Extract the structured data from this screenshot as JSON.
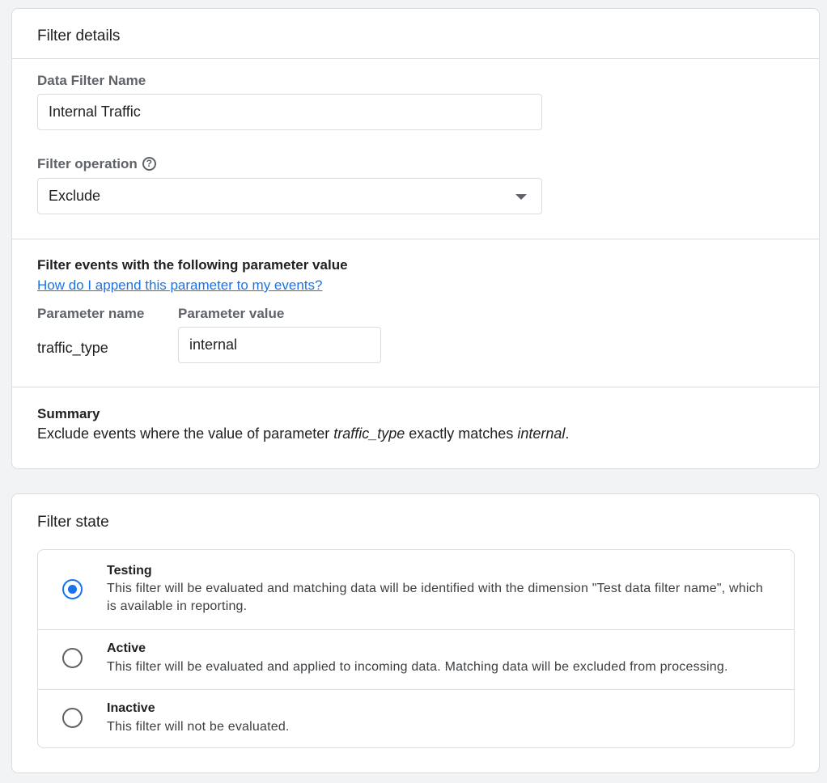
{
  "details": {
    "title": "Filter details",
    "name_label": "Data Filter Name",
    "name_value": "Internal Traffic",
    "operation_label": "Filter operation",
    "help_icon_glyph": "?",
    "operation_value": "Exclude"
  },
  "params": {
    "heading": "Filter events with the following parameter value",
    "help_link": "How do I append this parameter to my events?",
    "name_header": "Parameter name",
    "value_header": "Parameter value",
    "name": "traffic_type",
    "value": "internal"
  },
  "summary": {
    "heading": "Summary",
    "prefix": "Exclude events where the value of parameter ",
    "param": "traffic_type",
    "middle": " exactly matches ",
    "value": "internal",
    "suffix": "."
  },
  "state": {
    "title": "Filter state",
    "options": [
      {
        "title": "Testing",
        "description": "This filter will be evaluated and matching data will be identified with the dimension \"Test data filter name\", which is available in reporting.",
        "selected": true
      },
      {
        "title": "Active",
        "description": "This filter will be evaluated and applied to incoming data. Matching data will be excluded from processing.",
        "selected": false
      },
      {
        "title": "Inactive",
        "description": "This filter will not be evaluated.",
        "selected": false
      }
    ]
  },
  "colors": {
    "accent": "#1a73e8",
    "border": "#dadce0",
    "background": "#f1f3f4"
  }
}
